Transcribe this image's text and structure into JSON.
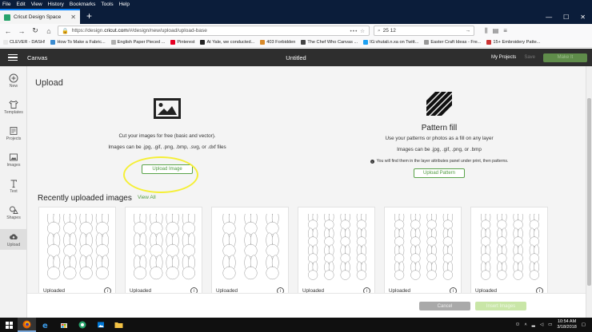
{
  "menubar": {
    "items": [
      "File",
      "Edit",
      "View",
      "History",
      "Bookmarks",
      "Tools",
      "Help"
    ]
  },
  "browser": {
    "tab_title": "Cricut Design Space",
    "url_prefix": "https://design.",
    "url_domain": "cricut.com",
    "url_rest": "/#/design/new/upload/upload-base",
    "url_actions": "••• ☆",
    "search_value": "25 12"
  },
  "bookmarks": [
    {
      "label": "CLEVER - DASH!",
      "color": "#e8e8e8"
    },
    {
      "label": "How To Make a Fabric...",
      "color": "#3b8bd0"
    },
    {
      "label": "English Paper Pieced ...",
      "color": "#b0b0b0"
    },
    {
      "label": "Pinterest",
      "color": "#e60023"
    },
    {
      "label": "At Yale, we conducted...",
      "color": "#222222"
    },
    {
      "label": "403 Forbidden",
      "color": "#d88a2a"
    },
    {
      "label": "The Chef Who Canvas ...",
      "color": "#444444"
    },
    {
      "label": "IG:vhutali.n.xa on Twitt...",
      "color": "#1da1f2"
    },
    {
      "label": "Easter Craft Ideas - Fre...",
      "color": "#999999"
    },
    {
      "label": "15+ Embroidery Patte...",
      "color": "#cc3333"
    }
  ],
  "app": {
    "canvas_label": "Canvas",
    "doc_title": "Untitled",
    "my_projects": "My Projects",
    "save": "Save",
    "make_it": "Make It"
  },
  "rail": [
    {
      "label": "New",
      "icon": "plus-icon"
    },
    {
      "label": "Templates",
      "icon": "shirt-icon"
    },
    {
      "label": "Projects",
      "icon": "projects-icon"
    },
    {
      "label": "Images",
      "icon": "image-icon"
    },
    {
      "label": "Text",
      "icon": "text-icon"
    },
    {
      "label": "Shapes",
      "icon": "shapes-icon"
    },
    {
      "label": "Upload",
      "icon": "upload-icon"
    }
  ],
  "upload": {
    "title": "Upload",
    "left_line1": "Cut your images for free (basic and vector).",
    "left_line2": "Images can be .jpg, .gif, .png, .bmp, .svg, or .dxf files",
    "upload_image_btn": "Upload Image",
    "pattern_title": "Pattern fill",
    "right_line1": "Use your patterns or photos as a fill on any layer",
    "right_line2": "Images can be .jpg, .gif, .png, or .bmp",
    "right_note": "You will find them in the layer attributes panel under print, then patterns.",
    "upload_pattern_btn": "Upload Pattern",
    "recent_title": "Recently uploaded images",
    "view_all": "View All",
    "cards": [
      {
        "label": "Uploaded",
        "cols": 4,
        "rows": 3
      },
      {
        "label": "Uploaded",
        "cols": 4,
        "rows": 3
      },
      {
        "label": "Uploaded",
        "cols": 3,
        "rows": 3
      },
      {
        "label": "Uploaded",
        "cols": 4,
        "rows": 4
      },
      {
        "label": "Uploaded",
        "cols": 4,
        "rows": 4
      },
      {
        "label": "Uploaded",
        "cols": 4,
        "rows": 4
      }
    ],
    "cancel_btn": "Cancel",
    "insert_btn": "Insert Images"
  },
  "taskbar": {
    "time": "10:54 AM",
    "date": "3/18/2018"
  }
}
